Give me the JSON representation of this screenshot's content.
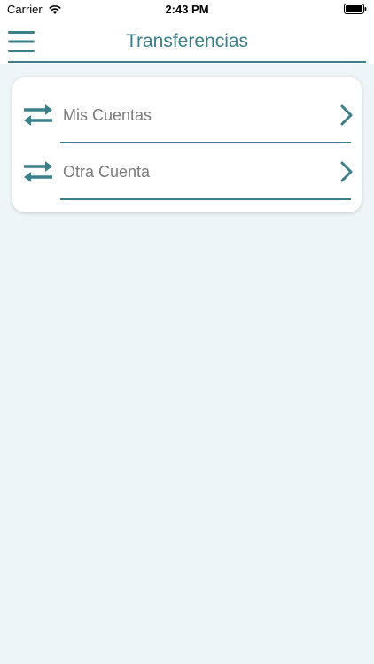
{
  "status_bar": {
    "carrier": "Carrier",
    "time": "2:43 PM"
  },
  "header": {
    "title": "Transferencias",
    "menu_icon": "hamburger-menu-icon"
  },
  "menu": {
    "items": [
      {
        "label": "Mis Cuentas",
        "icon": "transfer-arrows-icon",
        "trailing_icon": "chevron-right-icon"
      },
      {
        "label": "Otra Cuenta",
        "icon": "transfer-arrows-icon",
        "trailing_icon": "chevron-right-icon"
      }
    ]
  },
  "colors": {
    "accent": "#3a7f8a",
    "background": "#eef5f8",
    "card": "#ffffff",
    "text_secondary": "#7a7a7a"
  }
}
